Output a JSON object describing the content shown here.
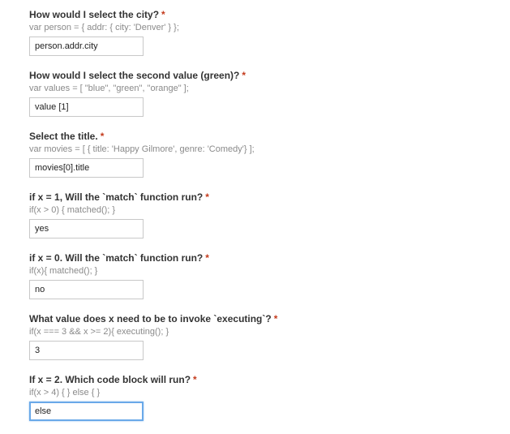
{
  "required_mark": "*",
  "questions": [
    {
      "title": "How would I select the city?",
      "help": "var person = { addr: { city: 'Denver' } };",
      "answer": "person.addr.city"
    },
    {
      "title": "How would I select the second value (green)?",
      "help": "var values = [ \"blue\", \"green\", \"orange\" ];",
      "answer": "value [1]"
    },
    {
      "title": "Select the title.",
      "help": "var movies = [ { title: 'Happy Gilmore', genre: 'Comedy'} ];",
      "answer": "movies[0].title"
    },
    {
      "title": "if x = 1, Will the `match` function run?",
      "help": "if(x > 0) { matched(); }",
      "answer": "yes"
    },
    {
      "title": "if x = 0. Will the `match` function run?",
      "help": "if(x){ matched(); }",
      "answer": "no"
    },
    {
      "title": "What value does x need to be to invoke `executing`?",
      "help": "if(x === 3 && x >= 2){ executing(); }",
      "answer": "3"
    },
    {
      "title": "If x = 2. Which code block will run?",
      "help": "if(x > 4) { } else { }",
      "answer": "else"
    }
  ],
  "colors": {
    "required": "#c43b1d",
    "focus_border": "#6aa9e9",
    "help_text": "#8a8a8a"
  }
}
